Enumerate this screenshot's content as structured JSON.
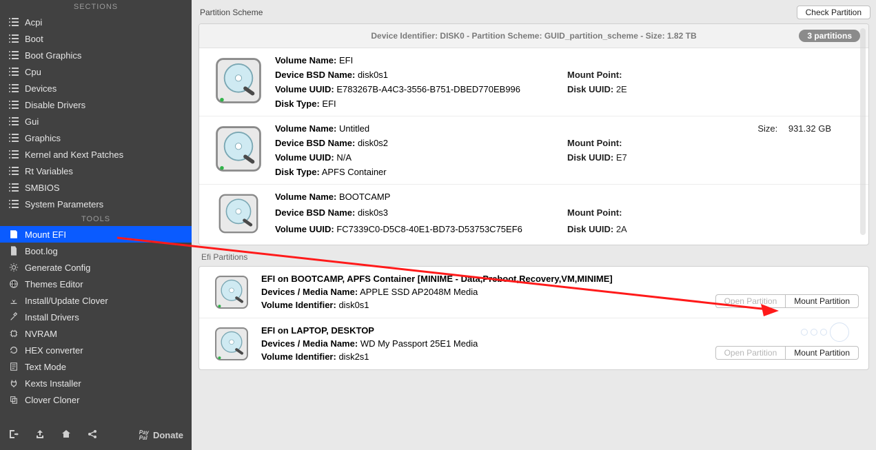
{
  "topbar": {
    "partition_scheme_label": "Partition Scheme",
    "check_partition_label": "Check Partition"
  },
  "scheme_header": {
    "device_identifier_label": "Device Identifier:",
    "device_identifier": "DISK0",
    "partition_scheme_label": "Partition Scheme:",
    "partition_scheme": "GUID_partition_scheme",
    "size_label": "Size:",
    "size": "1.82 TB",
    "badge": "3 partitions"
  },
  "partitions": [
    {
      "volume_name_label": "Volume Name:",
      "volume_name": "EFI",
      "bsd_label": "Device BSD Name:",
      "bsd": "disk0s1",
      "uuid_label": "Volume UUID:",
      "uuid": "E783267B-A4C3-3556-B751-DBED770EB996",
      "disk_type_label": "Disk Type:",
      "disk_type": "EFI",
      "mount_point_label": "Mount Point:",
      "disk_uuid_label": "Disk UUID:",
      "disk_uuid_prefix": "2E"
    },
    {
      "volume_name_label": "Volume Name:",
      "volume_name": "Untitled",
      "bsd_label": "Device BSD Name:",
      "bsd": "disk0s2",
      "uuid_label": "Volume UUID:",
      "uuid": "N/A",
      "disk_type_label": "Disk Type:",
      "disk_type": "APFS Container",
      "mount_point_label": "Mount Point:",
      "disk_uuid_label": "Disk UUID:",
      "disk_uuid_prefix": "E7",
      "size_label": "Size:",
      "size": "931.32 GB"
    },
    {
      "volume_name_label": "Volume Name:",
      "volume_name": "BOOTCAMP",
      "bsd_label": "Device BSD Name:",
      "bsd": "disk0s3",
      "uuid_label": "Volume UUID:",
      "uuid": "FC7339C0-D5C8-40E1-BD73-D53753C75EF6",
      "mount_point_label": "Mount Point:",
      "mount_point_prefix": "",
      "disk_uuid_label": "Disk UUID:",
      "disk_uuid_prefix": "2A"
    }
  ],
  "efi_section_label": "Efi Partitions",
  "efi": [
    {
      "title": "EFI on BOOTCAMP, APFS Container [MINIME - Data,Preboot,Recovery,VM,MINIME]",
      "media_label": "Devices / Media Name:",
      "media": "APPLE SSD AP2048M Media",
      "volid_label": "Volume Identifier:",
      "volid": "disk0s1",
      "open_label": "Open Partition",
      "mount_label": "Mount Partition"
    },
    {
      "title": "EFI on LAPTOP, DESKTOP",
      "media_label": "Devices / Media Name:",
      "media": "WD My Passport 25E1 Media",
      "volid_label": "Volume Identifier:",
      "volid": "disk2s1",
      "open_label": "Open Partition",
      "mount_label": "Mount Partition"
    }
  ],
  "sidebar": {
    "sections_label": "SECTIONS",
    "tools_label": "TOOLS",
    "sections": [
      {
        "label": "Acpi"
      },
      {
        "label": "Boot"
      },
      {
        "label": "Boot Graphics"
      },
      {
        "label": "Cpu"
      },
      {
        "label": "Devices"
      },
      {
        "label": "Disable Drivers"
      },
      {
        "label": "Gui"
      },
      {
        "label": "Graphics"
      },
      {
        "label": "Kernel and Kext Patches"
      },
      {
        "label": "Rt Variables"
      },
      {
        "label": "SMBIOS"
      },
      {
        "label": "System Parameters"
      }
    ],
    "tools": [
      {
        "label": "Mount EFI",
        "icon": "sd",
        "selected": true
      },
      {
        "label": "Boot.log",
        "icon": "doc"
      },
      {
        "label": "Generate Config",
        "icon": "gear"
      },
      {
        "label": "Themes Editor",
        "icon": "globe"
      },
      {
        "label": "Install/Update Clover",
        "icon": "download"
      },
      {
        "label": "Install Drivers",
        "icon": "wrench"
      },
      {
        "label": "NVRAM",
        "icon": "chip"
      },
      {
        "label": "HEX converter",
        "icon": "refresh"
      },
      {
        "label": "Text Mode",
        "icon": "text"
      },
      {
        "label": "Kexts Installer",
        "icon": "plug"
      },
      {
        "label": "Clover Cloner",
        "icon": "copy"
      }
    ],
    "donate_label": "Donate"
  }
}
